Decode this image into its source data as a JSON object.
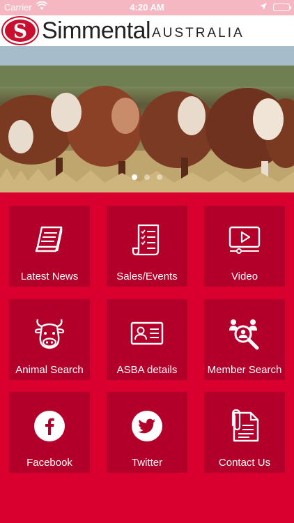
{
  "status_bar": {
    "carrier": "Carrier",
    "time": "4:20 AM"
  },
  "brand": {
    "logo_letter": "S",
    "name": "Simmental",
    "country": "AUSTRALIA"
  },
  "carousel": {
    "slide_count": 3,
    "active_slide": 1
  },
  "menu": {
    "tiles": [
      {
        "label": "Latest News",
        "icon": "book-icon"
      },
      {
        "label": "Sales/Events",
        "icon": "checklist-icon"
      },
      {
        "label": "Video",
        "icon": "video-icon"
      },
      {
        "label": "Animal Search",
        "icon": "cow-icon"
      },
      {
        "label": "ASBA details",
        "icon": "id-card-icon"
      },
      {
        "label": "Member Search",
        "icon": "member-search-icon"
      },
      {
        "label": "Facebook",
        "icon": "facebook-icon"
      },
      {
        "label": "Twitter",
        "icon": "twitter-icon"
      },
      {
        "label": "Contact Us",
        "icon": "document-clip-icon"
      }
    ]
  },
  "colors": {
    "background": "#d9002f",
    "tile": "#b3002a",
    "status_bar": "#f5b8c2",
    "brand_red": "#c8102e"
  }
}
